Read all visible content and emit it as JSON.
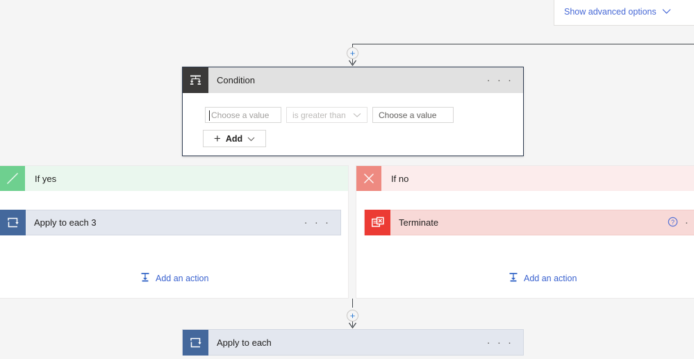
{
  "top_panel": {
    "advanced_options_label": "Show advanced options",
    "chevron_icon": "chevron-down-icon"
  },
  "condition_card": {
    "icon": "condition-branch-icon",
    "title": "Condition",
    "overflow_label": "· · ·",
    "fields": {
      "left_value": "Choose a value",
      "operator": "is greater than",
      "operator_chevron_icon": "chevron-down-icon",
      "right_value": "Choose a value"
    },
    "add_button": {
      "plus_icon": "plus-icon",
      "label": "Add",
      "chevron_icon": "chevron-down-icon"
    }
  },
  "branches": {
    "yes": {
      "icon": "check-icon",
      "label": "If yes",
      "action": {
        "icon": "apply-to-each-loop-icon",
        "title": "Apply to each 3",
        "overflow_label": "· · ·"
      },
      "add_action": {
        "icon": "add-action-icon",
        "label": "Add an action"
      }
    },
    "no": {
      "icon": "close-x-icon",
      "label": "If no",
      "action": {
        "icon": "terminate-icon",
        "title": "Terminate",
        "help_icon": "help-circle-icon",
        "overflow_label": "· ·"
      },
      "add_action": {
        "icon": "add-action-icon",
        "label": "Add an action"
      }
    }
  },
  "bottom_card": {
    "icon": "apply-to-each-loop-icon",
    "title": "Apply to each",
    "overflow_label": "· · ·"
  },
  "connectors": {
    "insert_plus_label": "+"
  },
  "colors": {
    "canvas": "#f5f5f5",
    "yes_accent": "#6ed08f",
    "no_accent": "#ee8a81",
    "loop_accent": "#44689c",
    "terminate_accent": "#ec3b34",
    "link_blue": "#3a62cf",
    "condition_header": "#e1e1e1"
  }
}
